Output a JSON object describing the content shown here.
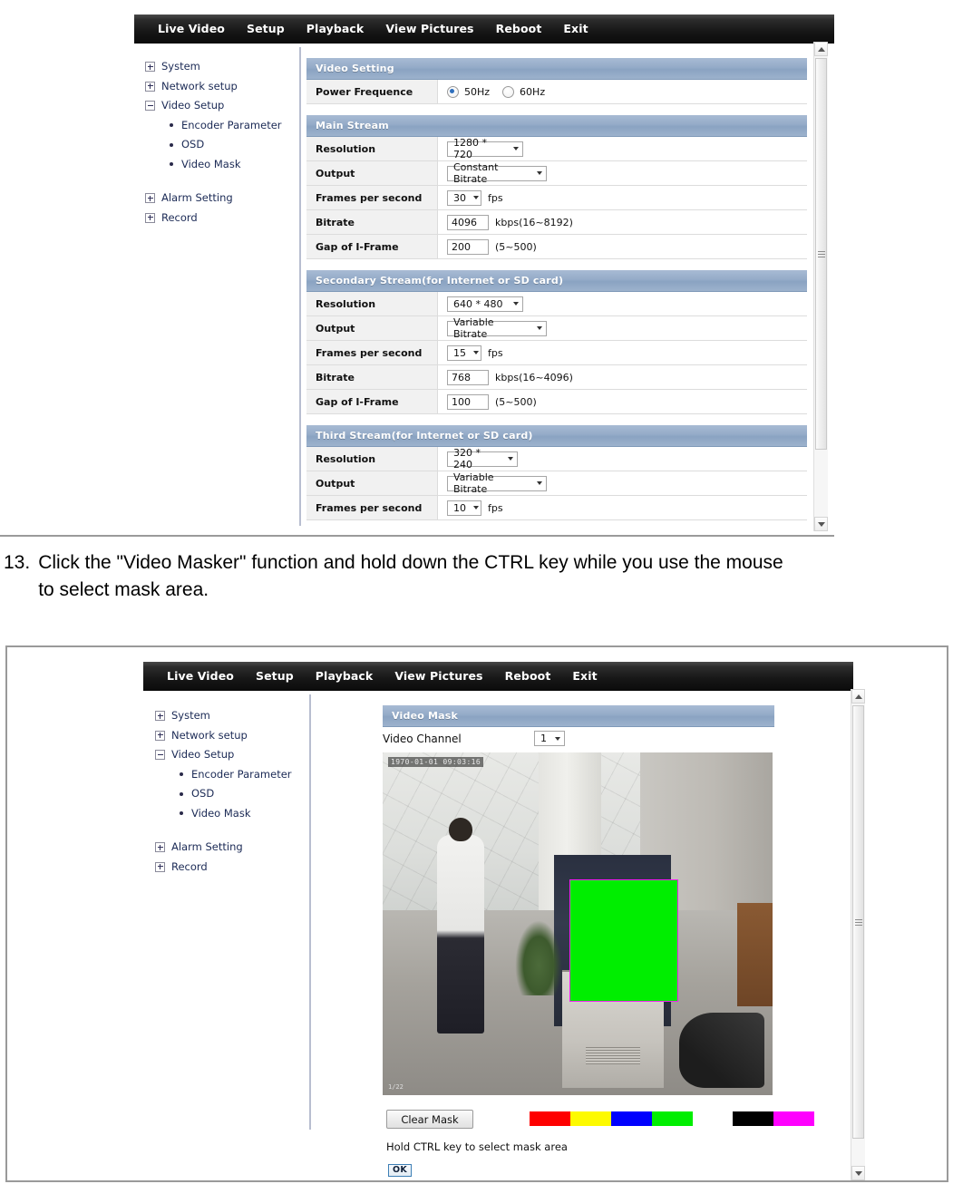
{
  "nav": {
    "items": [
      {
        "label": "Live Video",
        "name": "nav-live-video"
      },
      {
        "label": "Setup",
        "name": "nav-setup"
      },
      {
        "label": "Playback",
        "name": "nav-playback"
      },
      {
        "label": "View Pictures",
        "name": "nav-view-pictures"
      },
      {
        "label": "Reboot",
        "name": "nav-reboot"
      },
      {
        "label": "Exit",
        "name": "nav-exit"
      }
    ]
  },
  "sidebar": {
    "system": "System",
    "network_setup": "Network setup",
    "video_setup": "Video Setup",
    "encoder_parameter": "Encoder Parameter",
    "osd": "OSD",
    "video_mask": "Video Mask",
    "alarm_setting": "Alarm Setting",
    "record": "Record"
  },
  "encoder_page": {
    "video_setting": {
      "title": "Video Setting",
      "power_frequence_label": "Power Frequence",
      "options": [
        {
          "label": "50Hz",
          "selected": true
        },
        {
          "label": "60Hz",
          "selected": false
        }
      ]
    },
    "main_stream": {
      "title": "Main Stream",
      "resolution_label": "Resolution",
      "resolution_value": "1280 * 720",
      "output_label": "Output",
      "output_value": "Constant Bitrate",
      "fps_label": "Frames per second",
      "fps_value": "30",
      "fps_unit": "fps",
      "bitrate_label": "Bitrate",
      "bitrate_value": "4096",
      "bitrate_hint": "kbps(16~8192)",
      "gap_label": "Gap of I-Frame",
      "gap_value": "200",
      "gap_hint": "(5~500)"
    },
    "secondary_stream": {
      "title": "Secondary Stream(for Internet or SD card)",
      "resolution_label": "Resolution",
      "resolution_value": "640 * 480",
      "output_label": "Output",
      "output_value": "Variable Bitrate",
      "fps_label": "Frames per second",
      "fps_value": "15",
      "fps_unit": "fps",
      "bitrate_label": "Bitrate",
      "bitrate_value": "768",
      "bitrate_hint": "kbps(16~4096)",
      "gap_label": "Gap of I-Frame",
      "gap_value": "100",
      "gap_hint": "(5~500)"
    },
    "third_stream": {
      "title": "Third Stream(for Internet or SD card)",
      "resolution_label": "Resolution",
      "resolution_value": "320 * 240",
      "output_label": "Output",
      "output_value": "Variable Bitrate",
      "fps_label": "Frames per second",
      "fps_value": "10",
      "fps_unit": "fps"
    }
  },
  "instruction": {
    "number": "13.",
    "text": "Click the \"Video Masker\" function and hold down the CTRL key while you use the mouse to select mask area."
  },
  "mask_page": {
    "title": "Video Mask",
    "video_channel_label": "Video Channel",
    "video_channel_value": "1",
    "video": {
      "timestamp": "1970-01-01 09:03:16",
      "corner_label": "1/22"
    },
    "clear_mask_label": "Clear Mask",
    "hint": "Hold CTRL key to select mask area",
    "ok_label": "OK",
    "swatches": [
      {
        "name": "swatch-red",
        "color": "#fe0000"
      },
      {
        "name": "swatch-yellow",
        "color": "#fdfa00"
      },
      {
        "name": "swatch-blue",
        "color": "#0000fe"
      },
      {
        "name": "swatch-green",
        "color": "#00ee00"
      },
      {
        "name": "swatch-black",
        "color": "#000000"
      },
      {
        "name": "swatch-magenta",
        "color": "#fe00fe"
      }
    ],
    "mask_color": "#00ee00",
    "mask_border_color": "#ee22ee"
  }
}
